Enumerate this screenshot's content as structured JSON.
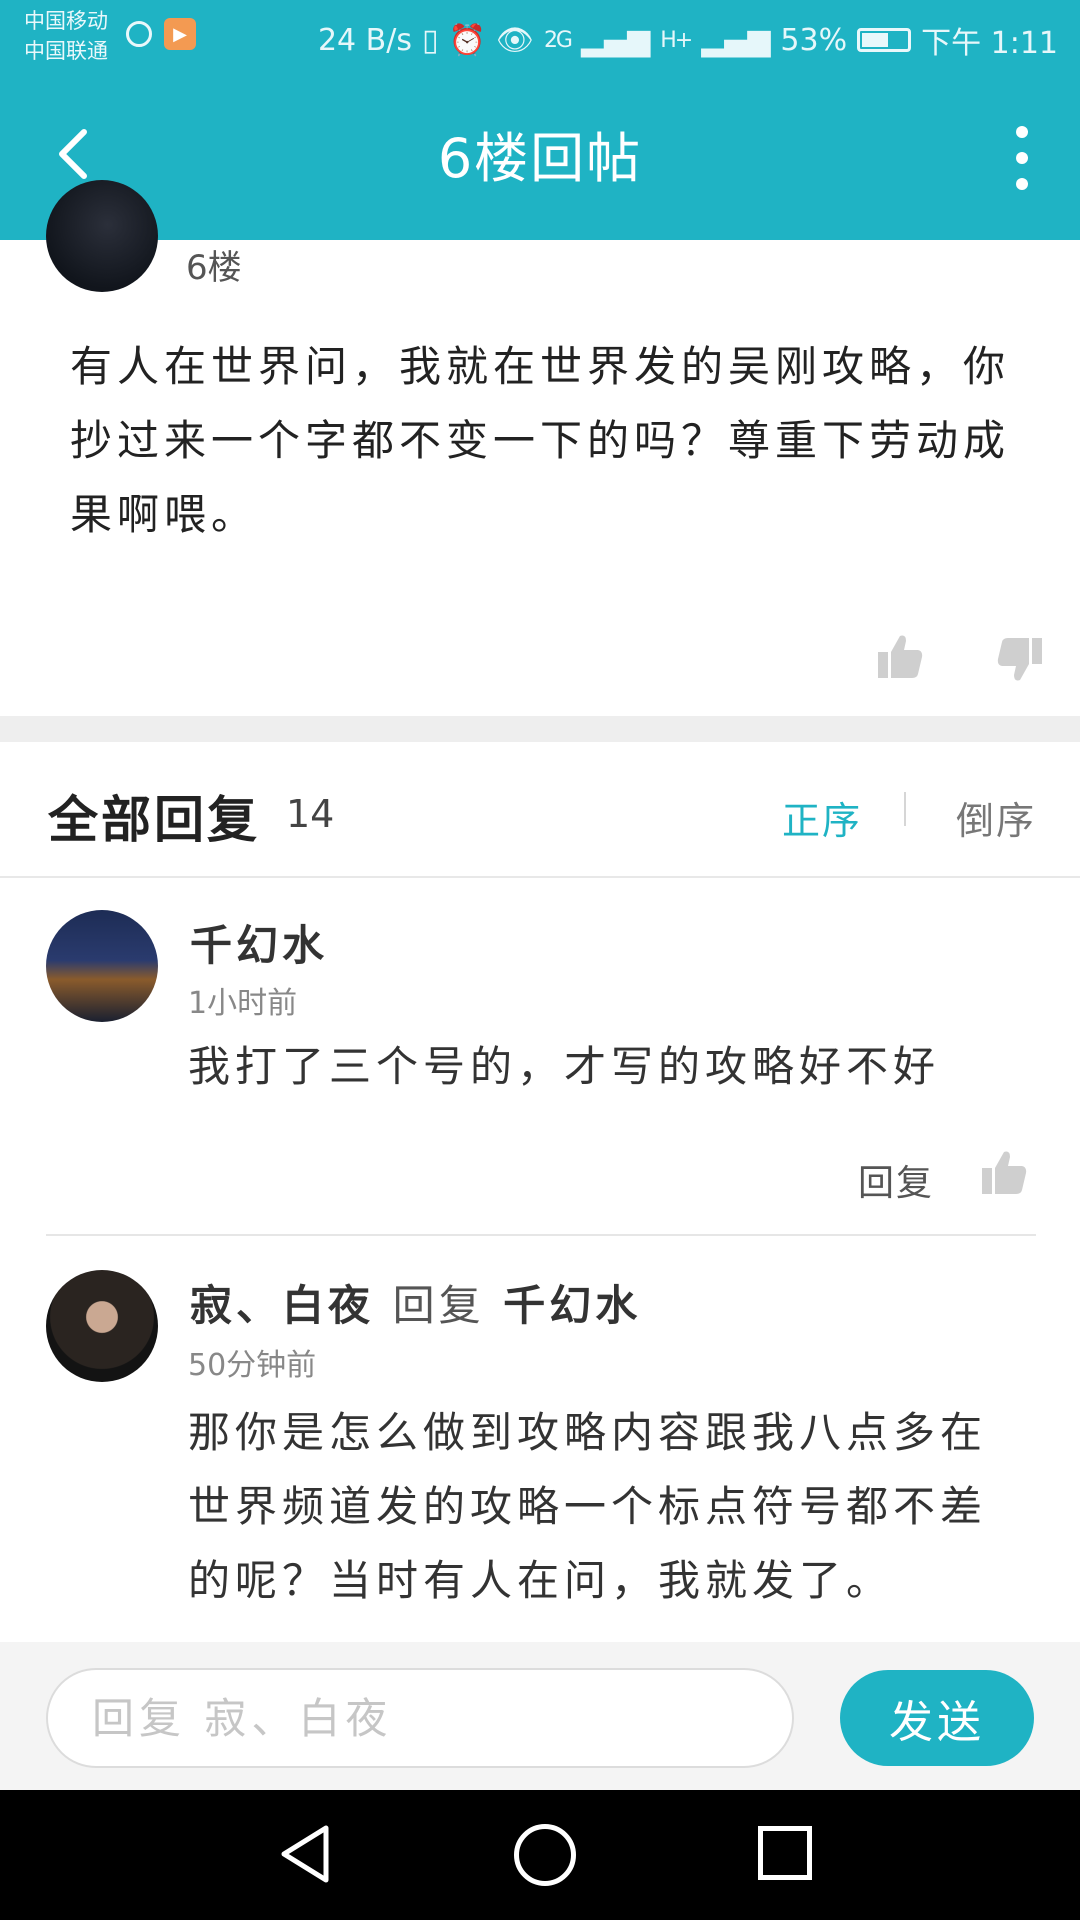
{
  "status_bar": {
    "carrier_1": "中国移动",
    "carrier_2": "中国联通",
    "net_speed": "24 B/s",
    "signal_2g": "2G",
    "signal_h": "H+",
    "battery": "53%",
    "time": "下午 1:11"
  },
  "app_bar": {
    "title": "6楼回帖",
    "back_icon": "chevron-left-icon",
    "more_icon": "more-vertical-icon"
  },
  "post": {
    "floor": "6楼",
    "body": "有人在世界问，我就在世界发的吴刚攻略，你抄过来一个字都不变一下的吗？尊重下劳动成果啊喂。"
  },
  "replies_header": {
    "title": "全部回复",
    "count": "14",
    "sort_asc": "正序",
    "sort_desc": "倒序"
  },
  "replies": [
    {
      "name": "千幻水",
      "time": "1小时前",
      "text": "我打了三个号的，才写的攻略好不好",
      "reply_label": "回复"
    },
    {
      "name": "寂、白夜",
      "reply_word": "回复",
      "reply_to": "千幻水",
      "time": "50分钟前",
      "text": "那你是怎么做到攻略内容跟我八点多在世界频道发的攻略一个标点符号都不差的呢？当时有人在问，我就发了。"
    }
  ],
  "input": {
    "placeholder": "回复 寂、白夜",
    "send_label": "发送"
  },
  "colors": {
    "accent": "#1fb3c4",
    "like_icon": "#cfcfcf"
  }
}
